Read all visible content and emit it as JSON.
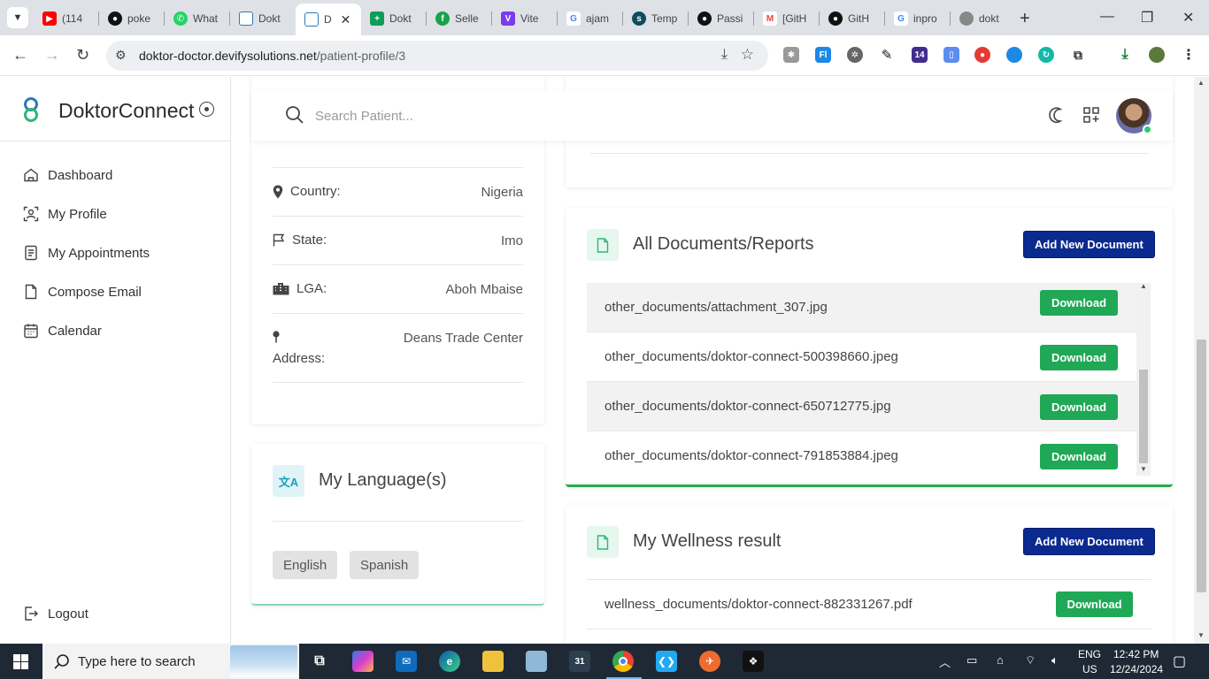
{
  "browser": {
    "tabs": [
      {
        "label": "(114",
        "icon": "youtube-icon",
        "color": "#ff0000"
      },
      {
        "label": "poke",
        "icon": "github-icon",
        "color": "#111111"
      },
      {
        "label": "What",
        "icon": "whatsapp-icon",
        "color": "#25d366"
      },
      {
        "label": "Dokt",
        "icon": "doktor-icon",
        "color": "#ffffff"
      },
      {
        "label": "D",
        "icon": "doktor-icon",
        "color": "#ffffff",
        "active": true
      },
      {
        "label": "Dokt",
        "icon": "sheets-icon",
        "color": "#0f9d58"
      },
      {
        "label": "Selle",
        "icon": "seller-icon",
        "color": "#16a34a"
      },
      {
        "label": "Vite",
        "icon": "vite-icon",
        "color": "#7c3aed"
      },
      {
        "label": "ajam",
        "icon": "google-icon",
        "color": "#ffffff"
      },
      {
        "label": "Temp",
        "icon": "template-icon",
        "color": "#0f4c5c"
      },
      {
        "label": "Passi",
        "icon": "github-icon",
        "color": "#111111"
      },
      {
        "label": "[GitH",
        "icon": "gmail-icon",
        "color": "#ffffff"
      },
      {
        "label": "GitH",
        "icon": "github-icon",
        "color": "#111111"
      },
      {
        "label": "inpro",
        "icon": "google-icon",
        "color": "#ffffff"
      },
      {
        "label": "dokt",
        "icon": "globe-icon",
        "color": "#888888"
      }
    ],
    "url_host": "doktor-doctor.devifysolutions.net",
    "url_path": "/patient-profile/3",
    "ext_badge": "14"
  },
  "sidebar": {
    "brand": "DoktorConnect",
    "items": [
      {
        "label": "Dashboard",
        "icon": "home-icon"
      },
      {
        "label": "My Profile",
        "icon": "profile-scan-icon"
      },
      {
        "label": "My Appointments",
        "icon": "appointments-icon"
      },
      {
        "label": "Compose Email",
        "icon": "document-icon"
      },
      {
        "label": "Calendar",
        "icon": "calendar-icon"
      }
    ],
    "logout": "Logout"
  },
  "header": {
    "search_placeholder": "Search Patient..."
  },
  "address_card": {
    "rows": [
      {
        "label": "Country:",
        "value": "Nigeria"
      },
      {
        "label": "State:",
        "value": "Imo"
      },
      {
        "label": "LGA:",
        "value": "Aboh Mbaise"
      },
      {
        "label": "Address:",
        "value": "Deans Trade Center"
      }
    ]
  },
  "languages_card": {
    "title": "My Language(s)",
    "languages": [
      "English",
      "Spanish"
    ]
  },
  "documents_card": {
    "title": "All Documents/Reports",
    "add_button": "Add New Document",
    "download_label": "Download",
    "files": [
      "other_documents/attachment_307.jpg",
      "other_documents/doktor-connect-500398660.jpeg",
      "other_documents/doktor-connect-650712775.jpg",
      "other_documents/doktor-connect-791853884.jpeg"
    ]
  },
  "wellness_card": {
    "title": "My Wellness result",
    "add_button": "Add New Document",
    "download_label": "Download",
    "files": [
      "wellness_documents/doktor-connect-882331267.pdf"
    ]
  },
  "taskbar": {
    "search_text": "Type here to search",
    "lang": "ENG",
    "region": "US",
    "time": "12:42 PM",
    "date": "12/24/2024"
  },
  "colors": {
    "primary": "#0b2a8f",
    "download": "#1fa855",
    "accent_green": "#2aa84a"
  }
}
